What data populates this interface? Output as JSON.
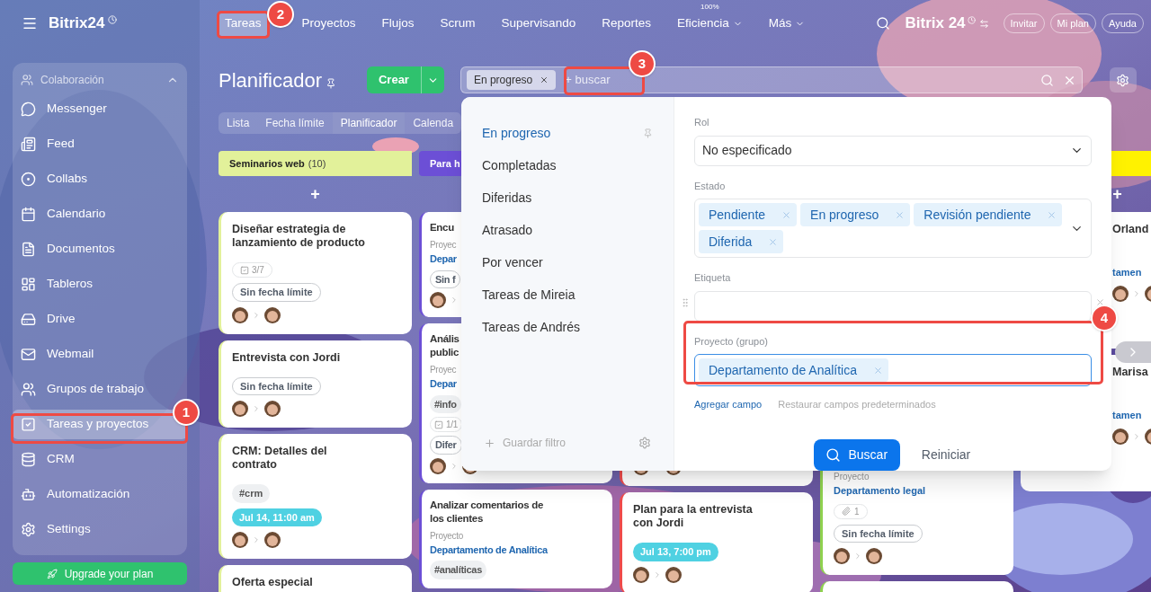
{
  "sidebar": {
    "logo": "Bitrix24",
    "section": {
      "label": "Colaboración",
      "expanded": true
    },
    "items": [
      {
        "label": "Messenger",
        "selected": false
      },
      {
        "label": "Feed",
        "selected": false
      },
      {
        "label": "Collabs",
        "selected": false
      },
      {
        "label": "Calendario",
        "selected": false
      },
      {
        "label": "Documentos",
        "selected": false
      },
      {
        "label": "Tableros",
        "selected": false
      },
      {
        "label": "Drive",
        "selected": false
      },
      {
        "label": "Webmail",
        "selected": false
      },
      {
        "label": "Grupos de trabajo",
        "selected": false
      },
      {
        "label": "Tareas y proyectos",
        "selected": true
      },
      {
        "label": "CRM",
        "selected": false
      },
      {
        "label": "Automatización",
        "selected": false
      },
      {
        "label": "Settings",
        "selected": false
      }
    ],
    "upgrade": "Upgrade your plan"
  },
  "nav": {
    "tabs": [
      {
        "label": "Tareas",
        "selected": true
      },
      {
        "label": "Proyectos",
        "selected": false
      },
      {
        "label": "Flujos",
        "selected": false
      },
      {
        "label": "Scrum",
        "selected": false
      },
      {
        "label": "Supervisando",
        "selected": false
      },
      {
        "label": "Reportes",
        "selected": false
      },
      {
        "label": "Eficiencia",
        "selected": false,
        "badge": "100%",
        "dropdown": true
      },
      {
        "label": "Más",
        "selected": false,
        "dropdown": true
      }
    ],
    "logo": "Bitrix 24",
    "buttons": [
      "Invitar",
      "Mi plan",
      "Ayuda"
    ]
  },
  "header": {
    "title": "Planificador",
    "create": "Crear",
    "search": {
      "chips": [
        "En progreso"
      ],
      "placeholder": "+ buscar"
    }
  },
  "views": [
    {
      "label": "Lista",
      "selected": false
    },
    {
      "label": "Fecha límite",
      "selected": false
    },
    {
      "label": "Planificador",
      "selected": true
    },
    {
      "label": "Calenda",
      "selected": false
    }
  ],
  "columns": [
    {
      "title": "Seminarios web",
      "count": "(10)",
      "color": "#e2f19a",
      "add": "+",
      "cards": [
        {
          "title": "Diseñar estrategia de\nlanzamiento de producto",
          "checklist": "3/7",
          "deadline": {
            "text": "Sin fecha límite",
            "kind": "none"
          },
          "color": "#e2f19a"
        },
        {
          "title": "Entrevista con Jordi",
          "deadline": {
            "text": "Sin fecha límite",
            "kind": "none"
          },
          "color": "#e2f19a"
        },
        {
          "title": "CRM: Detalles del\ncontrato",
          "tags": [
            "#crm"
          ],
          "deadline": {
            "text": "Jul 14, 11:00 am",
            "kind": "date"
          },
          "color": "#e2f19a"
        },
        {
          "title": "Oferta especial",
          "color": "#e2f19a"
        }
      ]
    },
    {
      "title": "Para h",
      "color": "#6c4fd6",
      "cards": [
        {
          "title": "Encu",
          "project_label": "Proyec",
          "project": "Depar",
          "deadline": {
            "text": "Sin f",
            "kind": "none"
          },
          "color": "#6c4fd6"
        },
        {
          "title": "Anális\npublic",
          "project_label": "Proyec",
          "project": "Depar",
          "tags": [
            "#info"
          ],
          "checklist": "1/1",
          "deadline": {
            "text": "Difer",
            "kind": "none"
          },
          "color": "#6c4fd6"
        },
        {
          "title": "Analizar comentarios de\nlos clientes",
          "project_label": "Proyecto",
          "project": "Departamento de Analítica",
          "tags": [
            "#analíticas"
          ],
          "color": "#6c4fd6"
        }
      ]
    },
    {
      "cards": [
        {
          "color": "#ef4b4b"
        },
        {
          "title": "Plan para la entrevista\ncon Jordi",
          "deadline": {
            "text": "Jul 13, 7:00 pm",
            "kind": "date"
          },
          "color": "#ef4b4b"
        }
      ]
    },
    {
      "cards": [
        {
          "project_label": "Proyecto",
          "project": "Departamento legal",
          "attachments": "1",
          "deadline": {
            "text": "Sin fecha límite",
            "kind": "none"
          },
          "color": "#8fd14f"
        },
        {
          "color": "#8fd14f"
        }
      ]
    },
    {
      "color": "#fff200",
      "add": "+",
      "cards": [
        {
          "title": "Orland",
          "project": "tamen"
        },
        {
          "title": "Marisa",
          "project": "tamen"
        }
      ]
    }
  ],
  "filter": {
    "presets": [
      {
        "label": "En progreso",
        "selected": true
      },
      {
        "label": "Completadas",
        "selected": false
      },
      {
        "label": "Diferidas",
        "selected": false
      },
      {
        "label": "Atrasado",
        "selected": false
      },
      {
        "label": "Por vencer",
        "selected": false
      },
      {
        "label": "Tareas de Mireia",
        "selected": false
      },
      {
        "label": "Tareas de Andrés",
        "selected": false
      }
    ],
    "save": "Guardar filtro",
    "fields": [
      {
        "kind": "select",
        "label": "Rol",
        "value": "No especificado"
      },
      {
        "kind": "chips",
        "label": "Estado",
        "chips": [
          "Pendiente",
          "En progreso",
          "Revisión pendiente",
          "Diferida"
        ],
        "dropdown": true
      },
      {
        "kind": "chips",
        "label": "Etiqueta",
        "removable": true
      },
      {
        "kind": "chips",
        "label": "Proyecto (grupo)",
        "chips": [
          "Departamento de Analítica"
        ],
        "focused": true
      }
    ],
    "add_field": "Agregar campo",
    "restore": "Restaurar campos predeterminados",
    "search": "Buscar",
    "reset": "Reiniciar"
  },
  "annotations": [
    {
      "number": "1"
    },
    {
      "number": "2"
    },
    {
      "number": "3"
    },
    {
      "number": "4"
    }
  ]
}
